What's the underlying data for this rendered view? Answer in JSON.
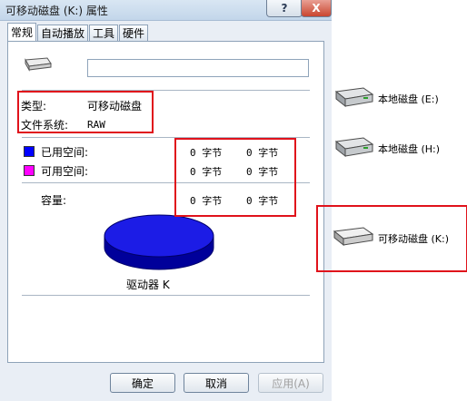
{
  "window": {
    "title": "可移动磁盘 (K:) 属性",
    "help_label": "?",
    "close_label": "X"
  },
  "tabs": [
    {
      "label": "常规",
      "active": true
    },
    {
      "label": "自动播放",
      "active": false
    },
    {
      "label": "工具",
      "active": false
    },
    {
      "label": "硬件",
      "active": false
    }
  ],
  "general": {
    "name_value": "",
    "type_label": "类型:",
    "type_value": "可移动磁盘",
    "fs_label": "文件系统:",
    "fs_value": "RAW",
    "used_label": "已用空间:",
    "used_bytes": "0 字节",
    "used_size": "0 字节",
    "free_label": "可用空间:",
    "free_bytes": "0 字节",
    "free_size": "0 字节",
    "capacity_label": "容量:",
    "capacity_bytes": "0 字节",
    "capacity_size": "0 字节",
    "drive_label": "驱动器 K",
    "used_color": "#0000ff",
    "free_color": "#ff00ff"
  },
  "buttons": {
    "ok": "确定",
    "cancel": "取消",
    "apply": "应用(A)"
  },
  "explorer": {
    "drives": [
      {
        "label": "本地磁盘 (E:)",
        "icon": "hard-drive-icon"
      },
      {
        "label": "本地磁盘 (H:)",
        "icon": "hard-drive-icon"
      },
      {
        "label": "可移动磁盘 (K:)",
        "icon": "removable-drive-icon"
      }
    ]
  }
}
